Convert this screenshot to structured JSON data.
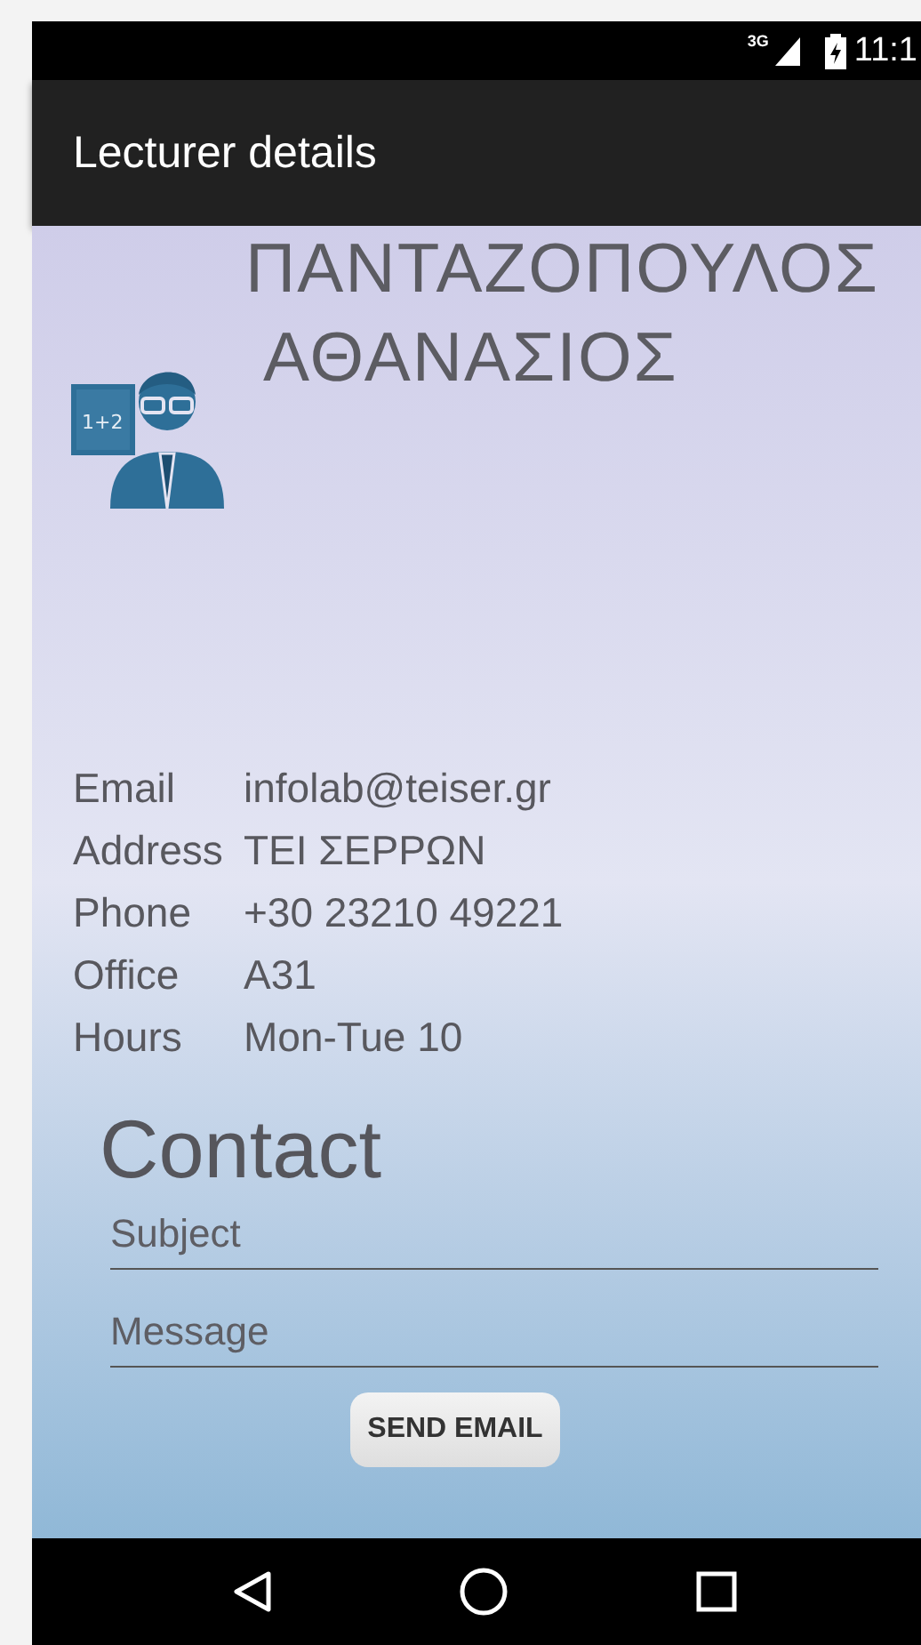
{
  "status_bar": {
    "network": "3G",
    "time": "11:1"
  },
  "app_bar": {
    "title": "Lecturer details"
  },
  "lecturer": {
    "name": "ΠΑΝΤΑΖΟΠΟΥΛΟΣ ΑΘΑΝΑΣΙΟΣ",
    "board_text": "1+2"
  },
  "details": [
    {
      "label": "Email",
      "value": "infolab@teiser.gr"
    },
    {
      "label": "Address",
      "value": "ΤΕΙ ΣΕΡΡΩΝ"
    },
    {
      "label": "Phone",
      "value": "+30 23210 49221"
    },
    {
      "label": "Office",
      "value": "A31"
    },
    {
      "label": "Hours",
      "value": "Mon-Tue 10"
    }
  ],
  "contact": {
    "heading": "Contact",
    "fields": [
      {
        "placeholder": "Subject"
      },
      {
        "placeholder": "Message"
      }
    ],
    "button": "SEND EMAIL"
  }
}
